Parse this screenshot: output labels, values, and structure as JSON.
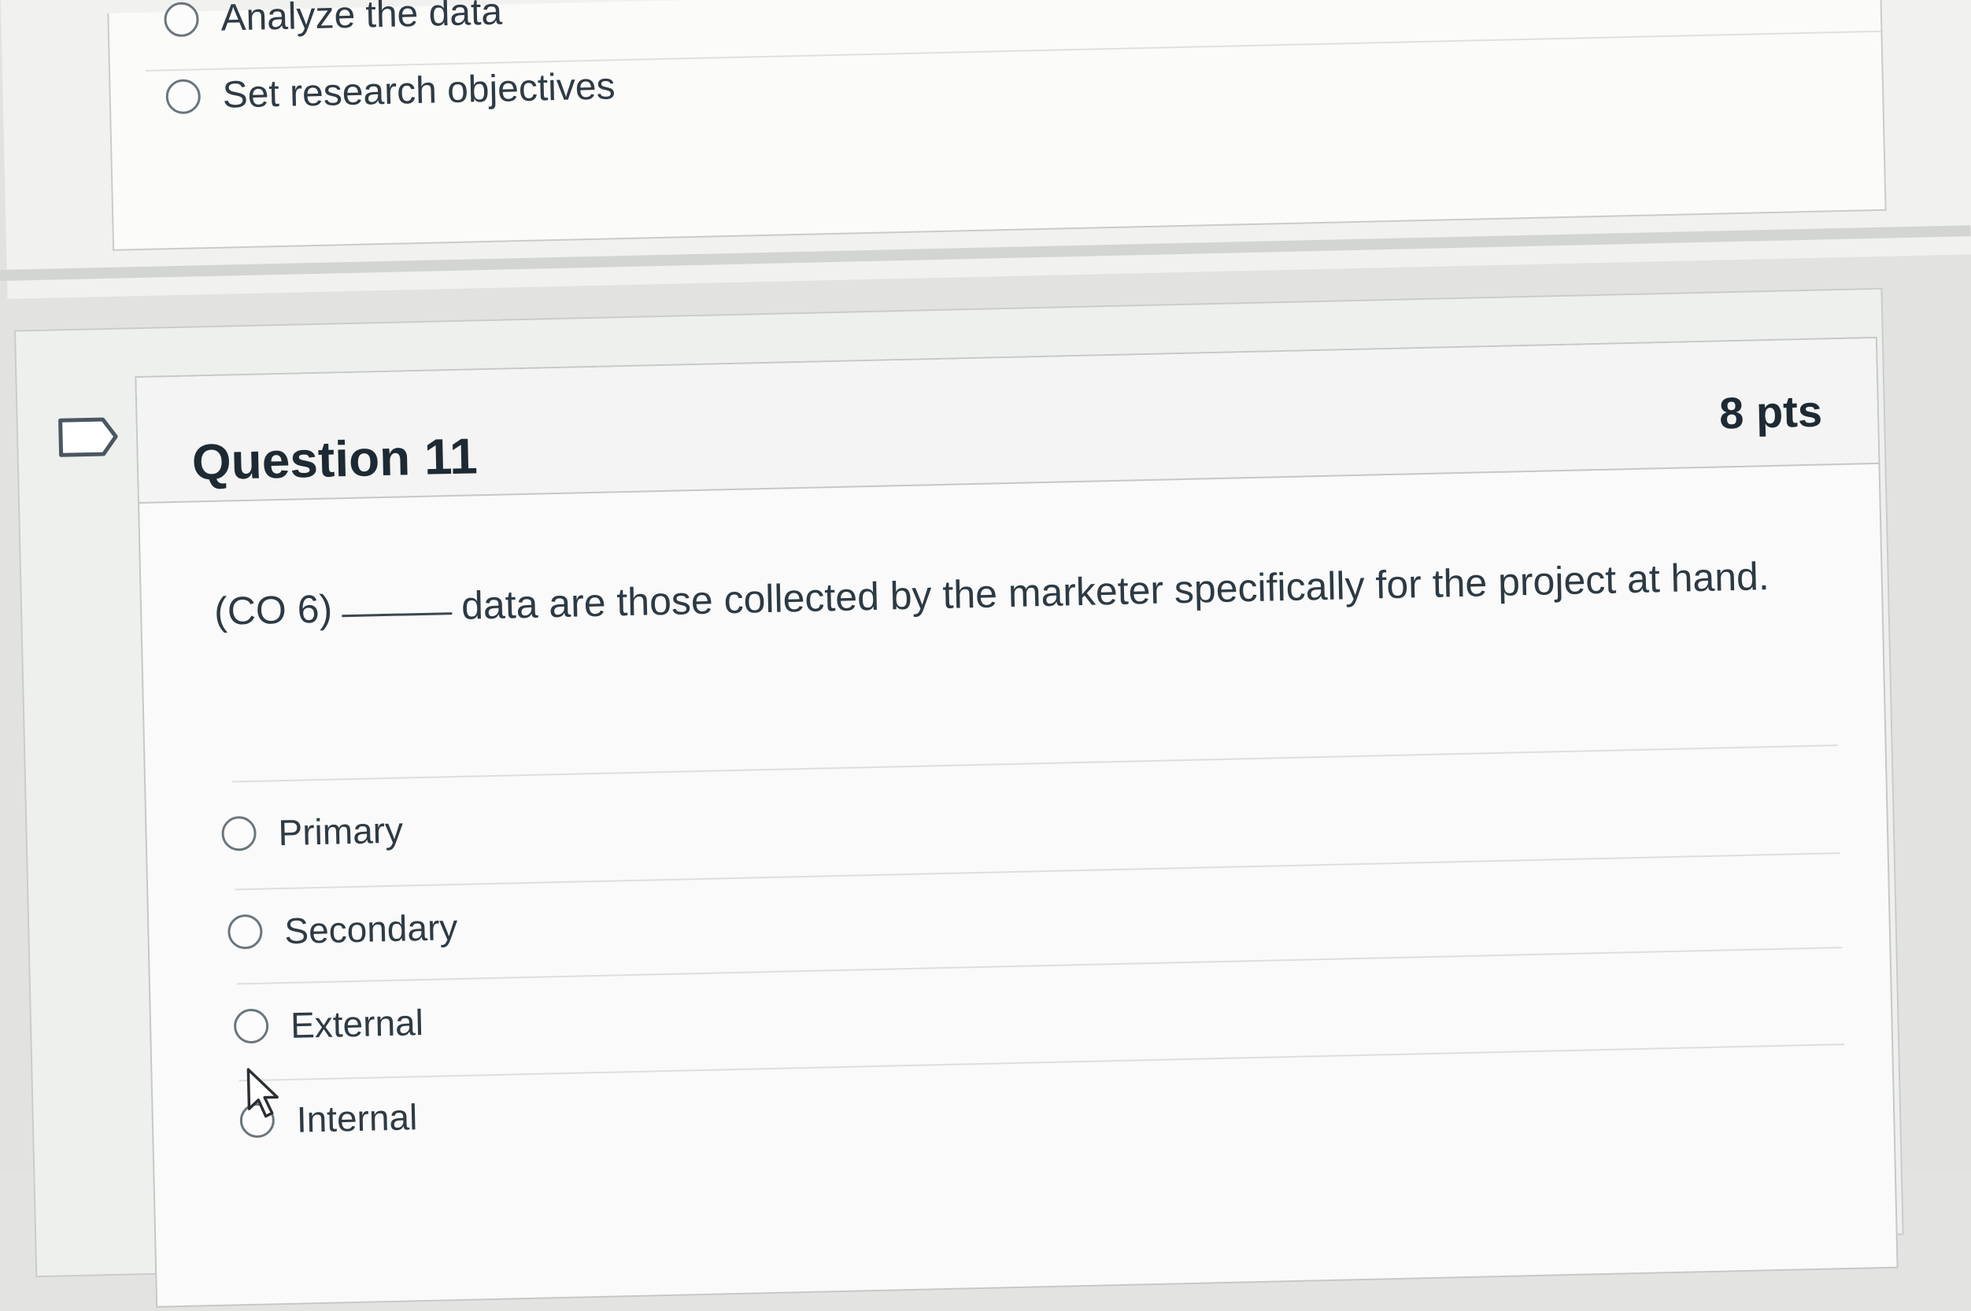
{
  "previous_question": {
    "choices": [
      {
        "label": "Analyze the data"
      },
      {
        "label": "Set research objectives"
      }
    ]
  },
  "question": {
    "title": "Question 11",
    "points": "8 pts",
    "text_before_blank": "(CO 6)",
    "text_after_blank": "data are those collected by the marketer specifically for the project at hand.",
    "choices": [
      {
        "label": "Primary"
      },
      {
        "label": "Secondary"
      },
      {
        "label": "External"
      },
      {
        "label": "Internal"
      }
    ]
  },
  "icons": {
    "flag": "flag-outline-icon",
    "cursor": "mouse-pointer-icon"
  },
  "colors": {
    "text": "#2d3b45",
    "border": "#c5c8c6",
    "background": "#f9faf9"
  }
}
